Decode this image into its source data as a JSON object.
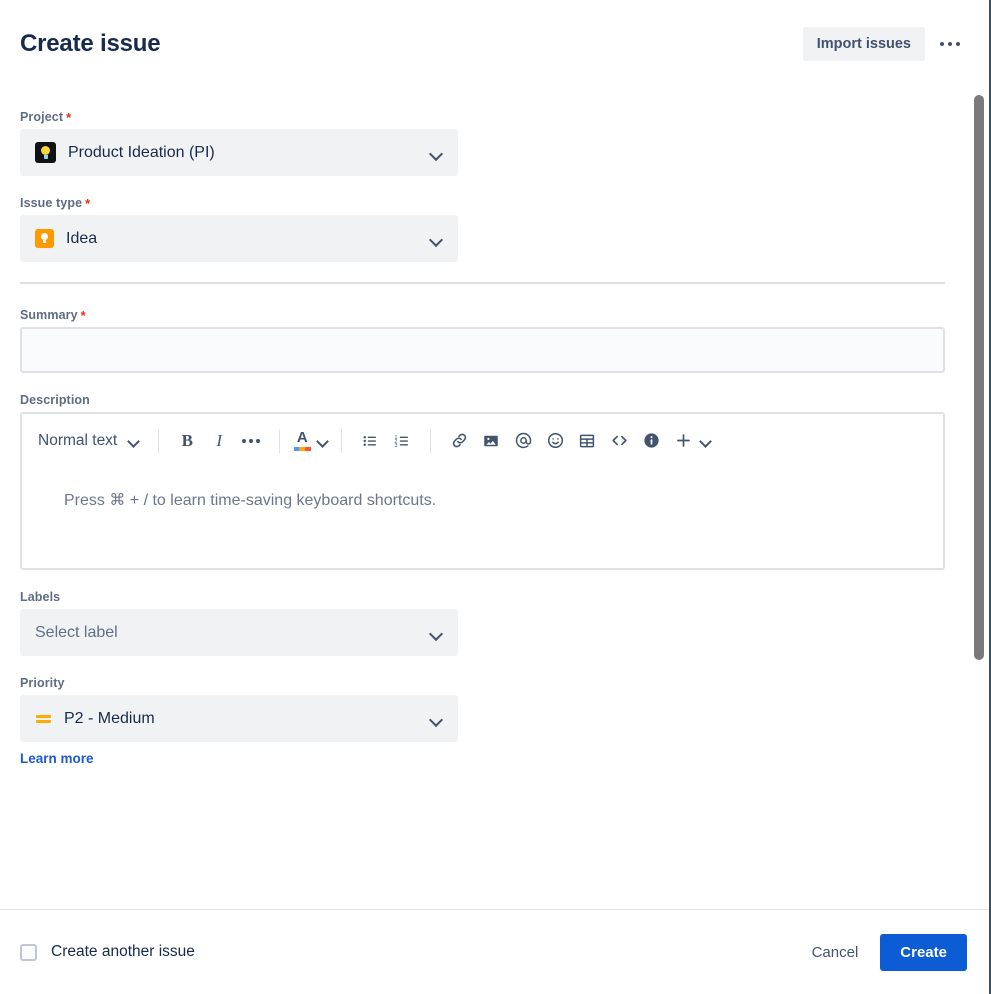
{
  "header": {
    "title": "Create issue",
    "import_button": "Import issues",
    "more_button": "•••"
  },
  "form": {
    "project": {
      "label": "Project",
      "required": "*",
      "value": "Product Ideation (PI)",
      "icon": "project-avatar-lightbulb"
    },
    "issue_type": {
      "label": "Issue type",
      "required": "*",
      "value": "Idea",
      "icon": "idea-lightbulb-icon"
    },
    "summary": {
      "label": "Summary",
      "required": "*",
      "value": "",
      "placeholder": ""
    },
    "description": {
      "label": "Description",
      "placeholder": "Press ⌘ + / to learn time-saving keyboard shortcuts.",
      "toolbar": {
        "text_style": "Normal text",
        "bold": "B",
        "italic": "I",
        "more_formatting": "•••",
        "text_color": "A",
        "bullet_list": "bullet-list-icon",
        "numbered_list": "numbered-list-icon",
        "link": "link-icon",
        "image": "image-icon",
        "mention": "@",
        "emoji": "emoji-icon",
        "table": "table-icon",
        "code": "<>",
        "info": "info-icon",
        "insert": "+"
      }
    },
    "labels": {
      "label": "Labels",
      "placeholder": "Select label"
    },
    "priority": {
      "label": "Priority",
      "value": "P2 - Medium",
      "icon": "priority-medium-icon",
      "learn_more": "Learn more"
    }
  },
  "footer": {
    "create_another_label": "Create another issue",
    "create_another_checked": false,
    "cancel_label": "Cancel",
    "create_label": "Create"
  },
  "colors": {
    "primary": "#0b5cd5",
    "link": "#1d58d5",
    "required": "#de350b",
    "priority_medium": "#ffab00",
    "issue_type": "#ff9900",
    "text": "#172b4d",
    "subtle_text": "#5e6c84"
  }
}
